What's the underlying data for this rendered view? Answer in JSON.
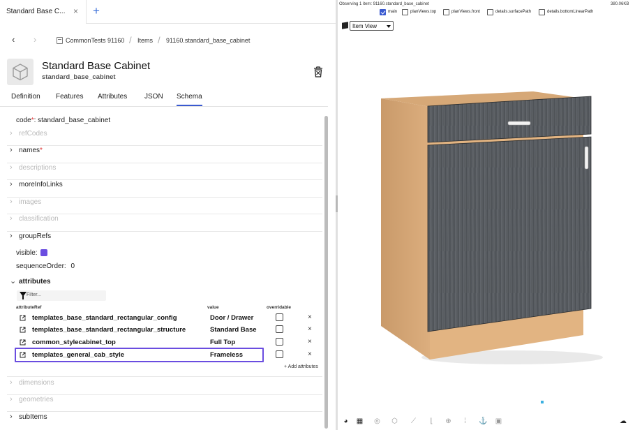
{
  "doc_tab": {
    "title": "Standard Base C...",
    "close": "×",
    "new_tab": "+"
  },
  "breadcrumb": {
    "back": "‹",
    "forward": "›",
    "items": [
      "CommonTests 91160",
      "Items",
      "91160.standard_base_cabinet"
    ],
    "sep": "/"
  },
  "header": {
    "title": "Standard Base Cabinet",
    "subtitle": "standard_base_cabinet"
  },
  "tabs": [
    "Definition",
    "Features",
    "Attributes",
    "JSON",
    "Schema"
  ],
  "active_tab": "Schema",
  "schema": {
    "code_label": "code",
    "required_mark": "*",
    "code_value": ": standard_base_cabinet",
    "collapsed": [
      {
        "label": "refCodes",
        "muted": true
      },
      {
        "label": "names",
        "required": true
      },
      {
        "label": "descriptions",
        "muted": true
      },
      {
        "label": "moreInfoLinks"
      },
      {
        "label": "images",
        "muted": true
      },
      {
        "label": "classification",
        "muted": true
      },
      {
        "label": "groupRefs"
      }
    ],
    "visible_label": "visible:",
    "visible_color": "#6a4de0",
    "sequence_label": "sequenceOrder:",
    "sequence_value": "0",
    "attributes_label": "attributes",
    "filter_placeholder": "Filter...",
    "columns": {
      "ref": "attributeRef",
      "value": "value",
      "overridable": "overridable"
    },
    "rows": [
      {
        "ref": "templates_base_standard_rectangular_config",
        "value": "Door / Drawer",
        "remove": "×"
      },
      {
        "ref": "templates_base_standard_rectangular_structure",
        "value": "Standard Base",
        "remove": "×"
      },
      {
        "ref": "common_stylecabinet_top",
        "value": "Full Top",
        "remove": "×"
      },
      {
        "ref": "templates_general_cab_style",
        "value": "Frameless",
        "remove": "×"
      }
    ],
    "add_attributes": "+ Add attributes",
    "lower": [
      {
        "label": "dimensions",
        "muted": true
      },
      {
        "label": "geometries",
        "muted": true
      },
      {
        "label": "subItems"
      }
    ]
  },
  "viewer": {
    "observing": "Observing 1 item: 91160.standard_base_cabinet",
    "size": "380.06KB",
    "views": [
      {
        "label": "main",
        "checked": true
      },
      {
        "label": "planViews.top",
        "checked": false
      },
      {
        "label": "planViews.front",
        "checked": false
      },
      {
        "label": "details.surfacePath",
        "checked": false
      },
      {
        "label": "details.bottomLinearPath",
        "checked": false
      }
    ],
    "mode_select": "Item View"
  },
  "colors": {
    "accent": "#3a5ad0",
    "highlight": "#6a4de0",
    "wood": "#e2b482",
    "door": "#5a5e63"
  }
}
